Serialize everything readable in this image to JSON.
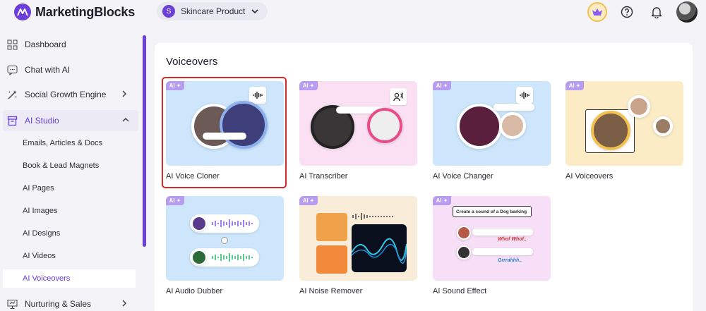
{
  "header": {
    "brand": "MarketingBlocks",
    "project": {
      "initial": "S",
      "name": "Skincare Product"
    }
  },
  "sidebar": {
    "items": [
      {
        "label": "Dashboard",
        "icon": "grid-icon"
      },
      {
        "label": "Chat with AI",
        "icon": "chat-icon"
      },
      {
        "label": "Social Growth Engine",
        "icon": "magic-wand-icon"
      },
      {
        "label": "AI Studio",
        "icon": "box-icon"
      },
      {
        "label": "Nurturing & Sales",
        "icon": "presentation-icon"
      }
    ],
    "studio_sub": [
      "Emails, Articles & Docs",
      "Book & Lead Magnets",
      "AI Pages",
      "AI Images",
      "AI Designs",
      "AI Videos",
      "AI Voiceovers"
    ]
  },
  "main": {
    "title": "Voiceovers",
    "ai_tag": "AI",
    "cards": [
      {
        "label": "AI Voice Cloner"
      },
      {
        "label": "AI Transcriber"
      },
      {
        "label": "AI Voice Changer"
      },
      {
        "label": "AI Voiceovers"
      },
      {
        "label": "AI Audio Dubber"
      },
      {
        "label": "AI Noise Remover"
      },
      {
        "label": "AI Sound Effect"
      }
    ],
    "sound_effect": {
      "prompt": "Create a sound of a Dog barking",
      "result1": "Whof Whof..",
      "result2": "Grrrahhh.."
    }
  },
  "colors": {
    "accent": "#6c3fd9",
    "selected_border": "#d62a2a"
  }
}
